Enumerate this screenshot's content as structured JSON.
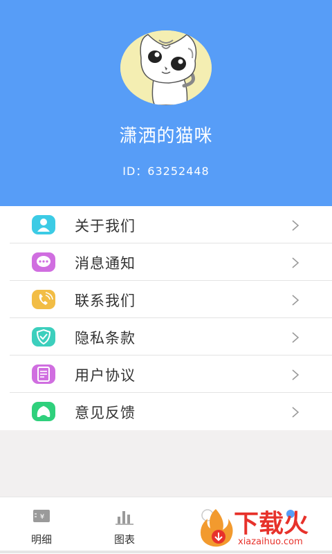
{
  "profile": {
    "username": "潇洒的猫咪",
    "id_text": "ID：63252448",
    "avatar_icon": "cat-avatar"
  },
  "menu": {
    "items": [
      {
        "label": "关于我们",
        "icon": "user-icon",
        "color": "#3ccbe5"
      },
      {
        "label": "消息通知",
        "icon": "chat-bubble-icon",
        "color": "#d06ee0"
      },
      {
        "label": "联系我们",
        "icon": "phone-icon",
        "color": "#f2bd45"
      },
      {
        "label": "隐私条款",
        "icon": "shield-check-icon",
        "color": "#3ccfbd"
      },
      {
        "label": "用户协议",
        "icon": "document-icon",
        "color": "#d06ee0"
      },
      {
        "label": "意见反馈",
        "icon": "feedback-icon",
        "color": "#2fd07c"
      }
    ]
  },
  "tabbar": {
    "tabs": [
      {
        "label": "明细",
        "icon": "receipt-icon"
      },
      {
        "label": "图表",
        "icon": "bar-chart-icon"
      },
      {
        "label": "",
        "icon": "tab-icon-3"
      },
      {
        "label": "",
        "icon": "tab-icon-4"
      }
    ]
  },
  "watermark": {
    "brand": "下载火",
    "url": "xiazaihuo.com"
  },
  "colors": {
    "header_bg": "#579df7",
    "page_bg": "#f2f0f0",
    "watermark_red": "#e7322b"
  }
}
